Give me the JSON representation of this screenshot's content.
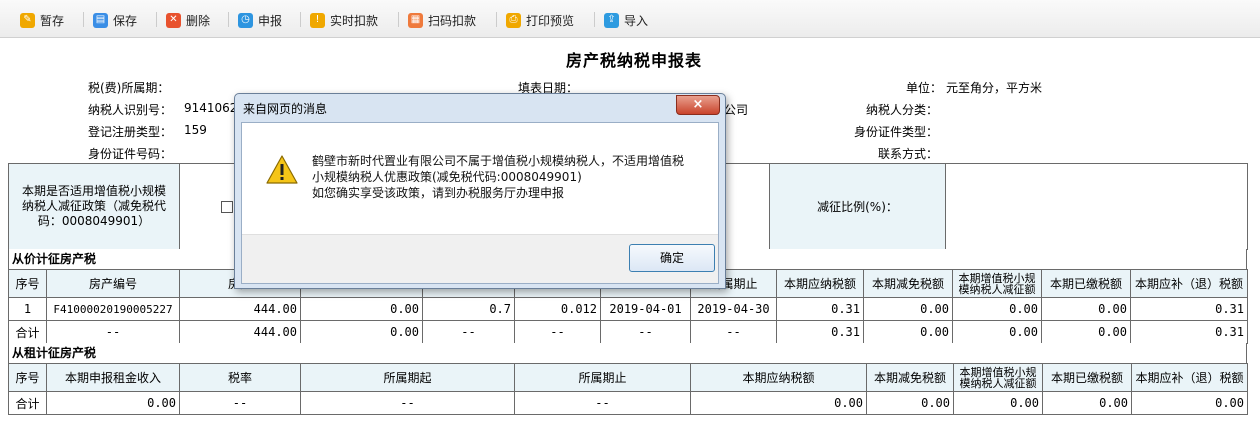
{
  "toolbar": {
    "buttons": [
      {
        "label": "暂存",
        "color": "#f0a800",
        "glyph": "✎"
      },
      {
        "label": "保存",
        "color": "#3a8ee6",
        "glyph": "▤"
      },
      {
        "label": "删除",
        "color": "#e8522e",
        "glyph": "✕"
      },
      {
        "label": "申报",
        "color": "#2e95e0",
        "glyph": "◷"
      },
      {
        "label": "实时扣款",
        "color": "#f0a800",
        "glyph": "!"
      },
      {
        "label": "扫码扣款",
        "color": "#ef7a3c",
        "glyph": "▦"
      },
      {
        "label": "打印预览",
        "color": "#f0a800",
        "glyph": "⎙"
      },
      {
        "label": "导入",
        "color": "#2e9be0",
        "glyph": "⇪"
      }
    ]
  },
  "form": {
    "title": "房产税纳税申报表",
    "period_label": "税(费)所属期：",
    "fill_date_label": "填表日期：",
    "unit_label": "单位：",
    "unit_value": "元至角分，平方米",
    "taxpayer_id_label": "纳税人识别号：",
    "taxpayer_id_value": "914106216",
    "taxpayer_name_tail": "公司",
    "taxpayer_category_label": "纳税人分类：",
    "reg_type_label": "登记注册类型：",
    "reg_type_value": "159",
    "id_type_label": "身份证件类型：",
    "id_no_label": "身份证件号码：",
    "contact_label": "联系方式："
  },
  "policy": {
    "question": "本期是否适用增值税小规模纳税人减征政策（减免税代码：0008049901）",
    "ratio_label": "减征比例(%)："
  },
  "price_section": {
    "title": "从价计征房产税",
    "headers": [
      "序号",
      "房产编号",
      "房产",
      "",
      "",
      "",
      "",
      "所属期止",
      "本期应纳税额",
      "本期减免税额",
      "本期增值税小规模纳税人减征额",
      "本期已缴税额",
      "本期应补（退）税额"
    ],
    "row": [
      "1",
      "F41000020190005227",
      "444.00",
      "0.00",
      "0.7",
      "0.012",
      "2019-04-01",
      "2019-04-30",
      "0.31",
      "0.00",
      "0.00",
      "0.00",
      "0.31"
    ],
    "total": [
      "合计",
      "--",
      "444.00",
      "0.00",
      "--",
      "--",
      "--",
      "--",
      "0.31",
      "0.00",
      "0.00",
      "0.00",
      "0.31"
    ]
  },
  "rent_section": {
    "title": "从租计征房产税",
    "headers": [
      "序号",
      "本期申报租金收入",
      "税率",
      "所属期起",
      "所属期止",
      "本期应纳税额",
      "本期减免税额",
      "本期增值税小规模纳税人减征额",
      "本期已缴税额",
      "本期应补（退）税额"
    ],
    "total": [
      "合计",
      "0.00",
      "--",
      "--",
      "--",
      "0.00",
      "0.00",
      "0.00",
      "0.00",
      "0.00"
    ]
  },
  "dialog": {
    "title": "来自网页的消息",
    "close": "×",
    "line1": "鹤壁市新时代置业有限公司不属于增值税小规模纳税人，不适用增值税",
    "line2": "小规模纳税人优惠政策(减免税代码:0008049901)",
    "line3": "如您确实享受该政策，请到办税服务厅办理申报",
    "ok": "确定"
  }
}
